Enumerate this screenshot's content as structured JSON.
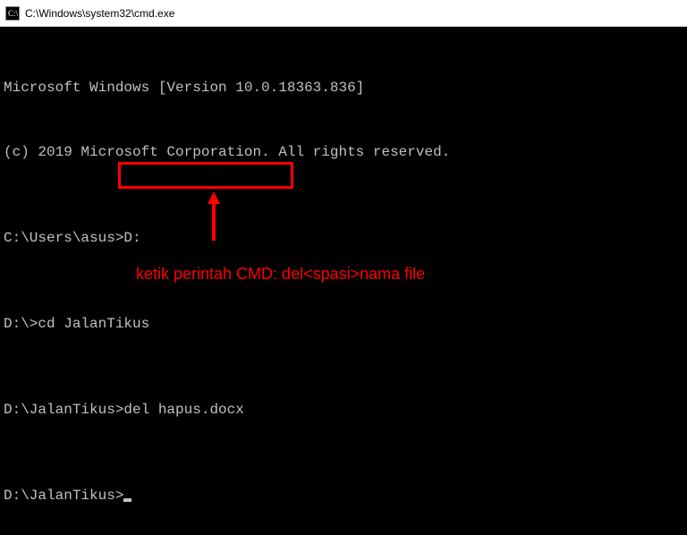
{
  "titlebar": {
    "path": "C:\\Windows\\system32\\cmd.exe"
  },
  "terminal": {
    "line1": "Microsoft Windows [Version 10.0.18363.836]",
    "line2": "(c) 2019 Microsoft Corporation. All rights reserved.",
    "prompt1": "C:\\Users\\asus>",
    "cmd1": "D:",
    "prompt2": "D:\\>",
    "cmd2": "cd JalanTikus",
    "prompt3": "D:\\JalanTikus>",
    "cmd3": "del hapus.docx",
    "prompt4": "D:\\JalanTikus>"
  },
  "annotation": {
    "text": "ketik perintah CMD: del<spasi>nama file"
  }
}
